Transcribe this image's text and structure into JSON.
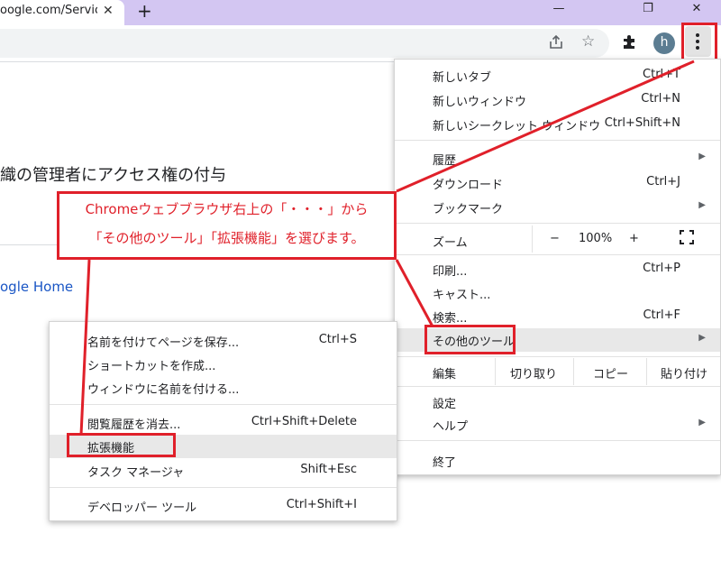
{
  "browser": {
    "tab_title": "oogle.com/Servic",
    "tab_close": "✕",
    "new_tab": "+",
    "window_controls": {
      "minimize": "—",
      "maximize": "❐",
      "close": "✕"
    },
    "avatar_letter": "h"
  },
  "page": {
    "heading": "織の管理者にアクセス権の付与",
    "link": "ogle Home"
  },
  "callout": {
    "line1": "Chromeウェブブラウザ右上の「・・・」から",
    "line2": "「その他のツール」「拡張機能」を選びます。"
  },
  "main_menu": {
    "new_tab": {
      "label": "新しいタブ",
      "shortcut": "Ctrl+T"
    },
    "new_window": {
      "label": "新しいウィンドウ",
      "shortcut": "Ctrl+N"
    },
    "new_incognito": {
      "label": "新しいシークレット ウィンドウ",
      "shortcut": "Ctrl+Shift+N"
    },
    "history": {
      "label": "履歴"
    },
    "downloads": {
      "label": "ダウンロード",
      "shortcut": "Ctrl+J"
    },
    "bookmarks": {
      "label": "ブックマーク"
    },
    "zoom": {
      "label": "ズーム",
      "minus": "−",
      "value": "100%",
      "plus": "+"
    },
    "print": {
      "label": "印刷...",
      "shortcut": "Ctrl+P"
    },
    "cast": {
      "label": "キャスト..."
    },
    "find": {
      "label": "検索...",
      "shortcut": "Ctrl+F"
    },
    "more_tools": {
      "label": "その他のツール"
    },
    "edit": {
      "label": "編集",
      "cut": "切り取り",
      "copy": "コピー",
      "paste": "貼り付け"
    },
    "settings": {
      "label": "設定"
    },
    "help": {
      "label": "ヘルプ"
    },
    "exit": {
      "label": "終了"
    }
  },
  "sub_menu": {
    "save_page": {
      "label": "名前を付けてページを保存...",
      "shortcut": "Ctrl+S"
    },
    "create_shortcut": {
      "label": "ショートカットを作成..."
    },
    "name_window": {
      "label": "ウィンドウに名前を付ける..."
    },
    "clear_data": {
      "label": "閲覧履歴を消去...",
      "shortcut": "Ctrl+Shift+Delete"
    },
    "extensions": {
      "label": "拡張機能"
    },
    "task_manager": {
      "label": "タスク マネージャ",
      "shortcut": "Shift+Esc"
    },
    "dev_tools": {
      "label": "デベロッパー ツール",
      "shortcut": "Ctrl+Shift+I"
    }
  },
  "colors": {
    "annotation_red": "#e0202a",
    "tab_strip": "#d3c6f2",
    "link_blue": "#1a56c5"
  }
}
